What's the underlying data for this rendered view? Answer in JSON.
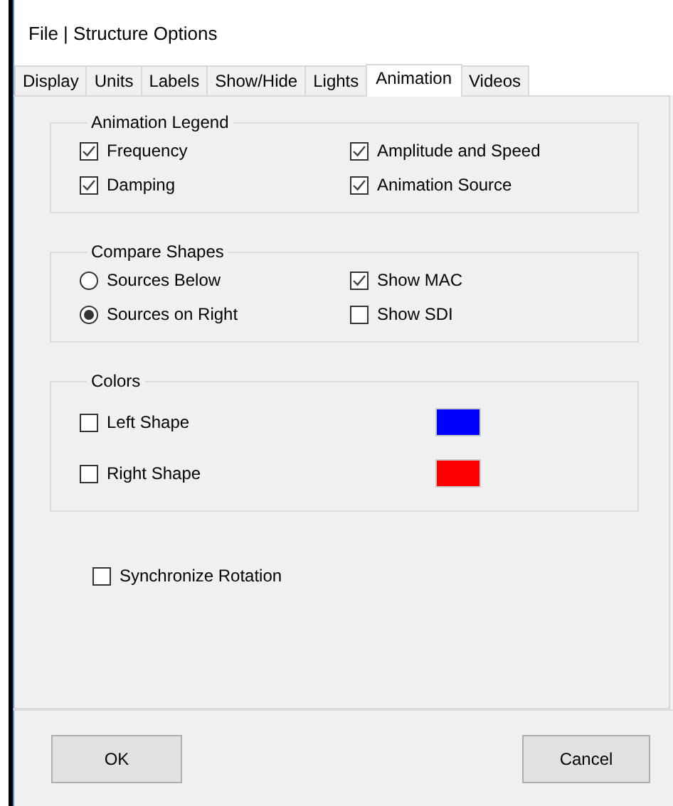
{
  "window": {
    "title": "File | Structure Options"
  },
  "tabs": [
    {
      "label": "Display",
      "selected": false
    },
    {
      "label": "Units",
      "selected": false
    },
    {
      "label": "Labels",
      "selected": false
    },
    {
      "label": "Show/Hide",
      "selected": false
    },
    {
      "label": "Lights",
      "selected": false
    },
    {
      "label": "Animation",
      "selected": true
    },
    {
      "label": "Videos",
      "selected": false
    }
  ],
  "animation_legend": {
    "title": "Animation Legend",
    "options": [
      {
        "label": "Frequency",
        "checked": true
      },
      {
        "label": "Amplitude and Speed",
        "checked": true
      },
      {
        "label": "Damping",
        "checked": true
      },
      {
        "label": "Animation Source",
        "checked": true
      }
    ]
  },
  "compare_shapes": {
    "title": "Compare Shapes",
    "options": [
      {
        "kind": "radio",
        "label": "Sources Below",
        "selected": false
      },
      {
        "kind": "checkbox",
        "label": "Show MAC",
        "checked": true
      },
      {
        "kind": "radio",
        "label": "Sources on Right",
        "selected": true
      },
      {
        "kind": "checkbox",
        "label": "Show SDI",
        "checked": false
      }
    ]
  },
  "colors": {
    "title": "Colors",
    "rows": [
      {
        "label": "Left Shape",
        "checked": false,
        "color": "#0000ff"
      },
      {
        "label": "Right Shape",
        "checked": false,
        "color": "#ff0000"
      }
    ]
  },
  "synchronize_rotation": {
    "label": "Synchronize Rotation",
    "checked": false
  },
  "buttons": [
    "OK",
    "Cancel"
  ]
}
